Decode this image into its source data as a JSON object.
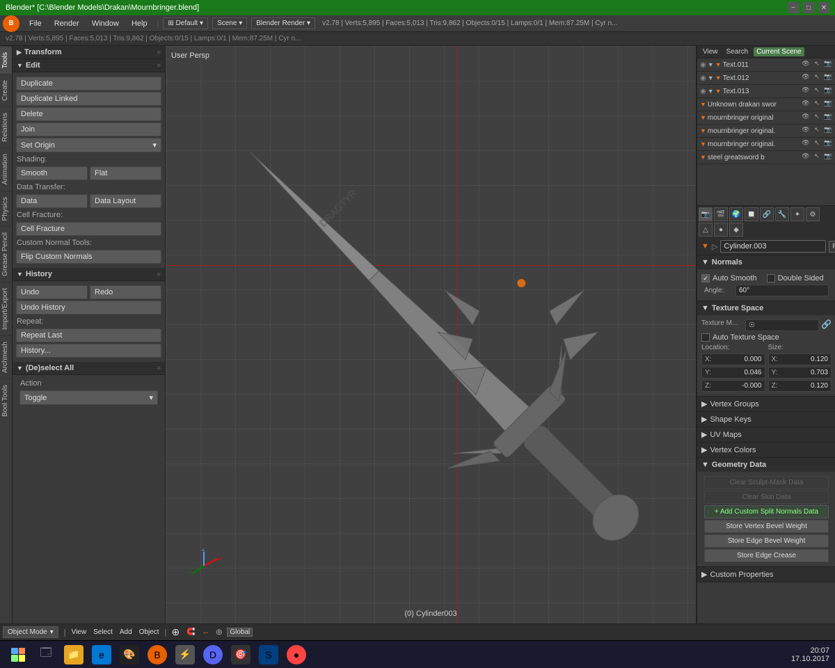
{
  "titlebar": {
    "title": "Blender*  [C:\\Blender Models\\Drakan\\Mournbringer.blend]",
    "min": "−",
    "max": "□",
    "close": "✕"
  },
  "menubar": {
    "logo": "B",
    "items": [
      "File",
      "Render",
      "Window",
      "Help"
    ],
    "workspace": "Default",
    "scene": "Scene",
    "renderer": "Blender Render",
    "version_info": "v2.78 | Verts:5,895 | Faces:5,013 | Tris:9,862 | Objects:0/15 | Lamps:0/1 | Mem:87.25M | Cyr n..."
  },
  "left_tabs": {
    "items": [
      "Tools",
      "Create",
      "Relations",
      "Animation",
      "Physics",
      "Grease Pencil",
      "Import/Export",
      "Archmesh",
      "Bool Tools"
    ]
  },
  "tools_panel": {
    "transform_label": "Transform",
    "edit_label": "Edit",
    "duplicate": "Duplicate",
    "duplicate_linked": "Duplicate Linked",
    "delete": "Delete",
    "join": "Join",
    "set_origin": "Set Origin",
    "shading_label": "Shading:",
    "smooth": "Smooth",
    "flat": "Flat",
    "data_transfer_label": "Data Transfer:",
    "data": "Data",
    "data_layout": "Data Layout",
    "cell_fracture_label": "Cell Fracture:",
    "cell_fracture": "Cell Fracture",
    "custom_normal_label": "Custom Normal Tools:",
    "flip_custom": "Flip Custom Normals",
    "history_label": "History",
    "undo": "Undo",
    "redo": "Redo",
    "undo_history": "Undo History",
    "repeat_label": "Repeat:",
    "repeat_last": "Repeat Last",
    "history_dots": "History...",
    "deselect_label": "(De)select All",
    "action_label": "Action",
    "toggle": "Toggle"
  },
  "viewport": {
    "label": "User Persp",
    "status": "(0) Cylinder003"
  },
  "outliner": {
    "headers": [
      "View",
      "Search",
      "Current Scene"
    ],
    "items": [
      {
        "icon": "▼",
        "name": "Text.011",
        "indent": 0
      },
      {
        "icon": "▼",
        "name": "Text.012",
        "indent": 0
      },
      {
        "icon": "▼",
        "name": "Text.013",
        "indent": 0
      },
      {
        "icon": "▼",
        "name": "Unknown drakan swor",
        "indent": 0
      },
      {
        "icon": "▼",
        "name": "mournbringer original",
        "indent": 0
      },
      {
        "icon": "▼",
        "name": "mournbringer original.",
        "indent": 0
      },
      {
        "icon": "▼",
        "name": "mournbringer original.",
        "indent": 0
      },
      {
        "icon": "▼",
        "name": "steel greatsword b",
        "indent": 0
      }
    ]
  },
  "properties": {
    "obj_name": "Cylinder.003",
    "f_badge": "F",
    "normals_label": "Normals",
    "auto_smooth": "Auto Smooth",
    "double_sided": "Double Sided",
    "angle_label": "Angle:",
    "angle_value": "60°",
    "texture_space_label": "Texture Space",
    "texture_m_label": "Texture M...",
    "auto_texture_space": "Auto Texture Space",
    "location_label": "Location:",
    "size_label": "Size:",
    "loc_x": "X:",
    "loc_x_val": "0.000",
    "loc_y": "Y:",
    "loc_y_val": "0.046",
    "loc_z": "Z:",
    "loc_z_val": "-0.000",
    "size_x": "X:",
    "size_x_val": "0.120",
    "size_y": "Y:",
    "size_y_val": "0.703",
    "size_z": "Z:",
    "size_z_val": "0.120",
    "vertex_groups": "Vertex Groups",
    "shape_keys": "Shape Keys",
    "uv_maps": "UV Maps",
    "vertex_colors": "Vertex Colors",
    "geometry_data": "Geometry Data",
    "clear_sculpt": "Clear Sculpt-Mask Data",
    "clear_skin": "Clear Skin Data",
    "add_custom_split": "Add Custom Split Normals Data",
    "store_vertex_bevel": "Store Vertex Bevel Weight",
    "store_edge_bevel": "Store Edge Bevel Weight",
    "store_edge_crease": "Store Edge Crease",
    "custom_properties": "Custom Properties"
  },
  "bottom_bar": {
    "mode": "Object Mode",
    "view": "View",
    "select": "Select",
    "add": "Add",
    "object": "Object"
  },
  "taskbar": {
    "time": "20:07",
    "date": "17.10.2017",
    "apps": [
      "⊞",
      "🗔",
      "📁",
      "🌐",
      "🎨",
      "Ω",
      "⚡",
      "🔵",
      "🎯",
      "🌀",
      "🔴"
    ]
  }
}
